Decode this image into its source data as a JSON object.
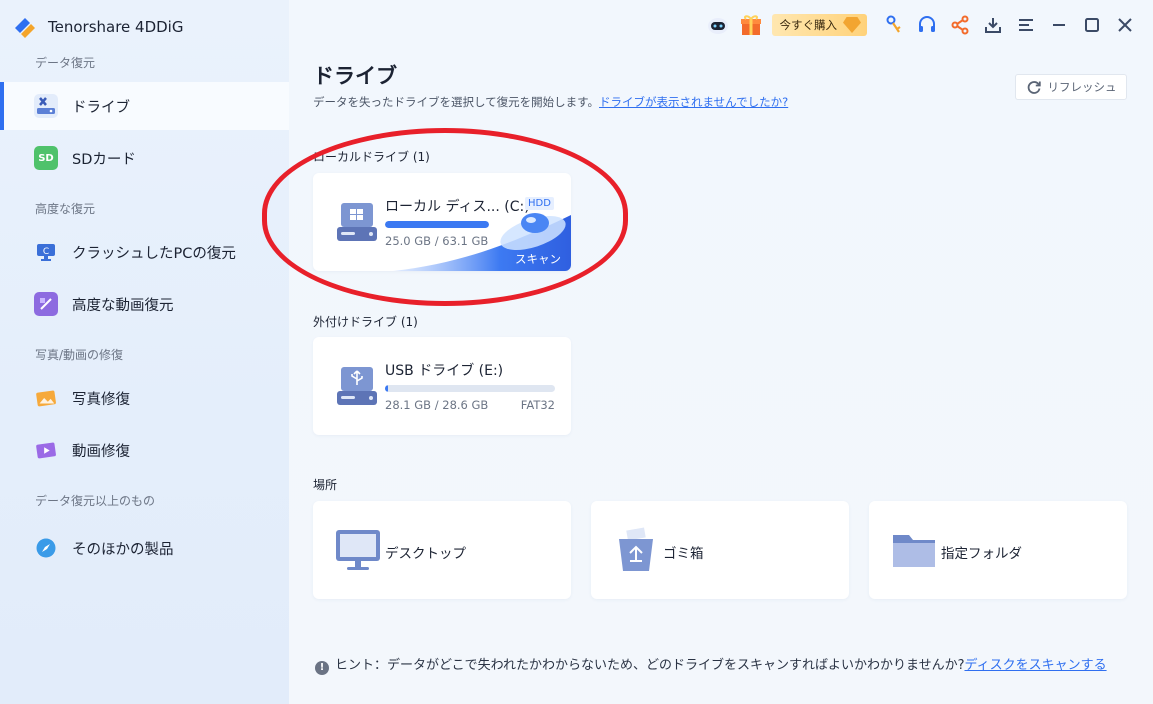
{
  "app": {
    "title": "Tenorshare 4DDiG"
  },
  "sidebar": {
    "sections": [
      {
        "label": "データ復元"
      },
      {
        "label": "高度な復元"
      },
      {
        "label": "写真/動画の修復"
      },
      {
        "label": "データ復元以上のもの"
      }
    ],
    "items": [
      {
        "label": "ドライブ",
        "icon": "drive-tools-icon",
        "active": true
      },
      {
        "label": "SDカード",
        "icon": "sd-card-icon"
      },
      {
        "label": "クラッシュしたPCの復元",
        "icon": "crashed-pc-icon"
      },
      {
        "label": "高度な動画復元",
        "icon": "video-recovery-icon"
      },
      {
        "label": "写真修復",
        "icon": "photo-repair-icon"
      },
      {
        "label": "動画修復",
        "icon": "video-repair-icon"
      },
      {
        "label": "そのほかの製品",
        "icon": "compass-icon"
      }
    ]
  },
  "topbar": {
    "buy_label": "今すぐ購入"
  },
  "main": {
    "title": "ドライブ",
    "subtitle": "データを失ったドライブを選択して復元を開始します。",
    "subtitle_link": "ドライブが表示されませんでしたか?",
    "refresh_label": "リフレッシュ",
    "local_group": "ローカルドライブ (1)",
    "external_group": "外付けドライブ (1)",
    "location_group": "場所",
    "local_drive": {
      "name": "ローカル ディス... (C:)",
      "badge": "HDD",
      "size": "25.0 GB / 63.1 GB",
      "used_fraction": 0.4,
      "scan_label": "スキャン"
    },
    "usb_drive": {
      "name": "USB ドライブ (E:)",
      "size": "28.1 GB / 28.6 GB",
      "fs": "FAT32",
      "used_fraction": 0.02
    },
    "locations": [
      {
        "label": "デスクトップ",
        "icon": "desktop-icon"
      },
      {
        "label": "ゴミ箱",
        "icon": "recycle-bin-icon"
      },
      {
        "label": "指定フォルダ",
        "icon": "folder-icon"
      }
    ],
    "hint_text": "ヒント：データがどこで失われたかわからないため、どのドライブをスキャンすればよいかわかりませんか?",
    "hint_link": "ディスクをスキャンする"
  },
  "colors": {
    "accent": "#2f6ff0",
    "annotation": "#e8202a"
  }
}
